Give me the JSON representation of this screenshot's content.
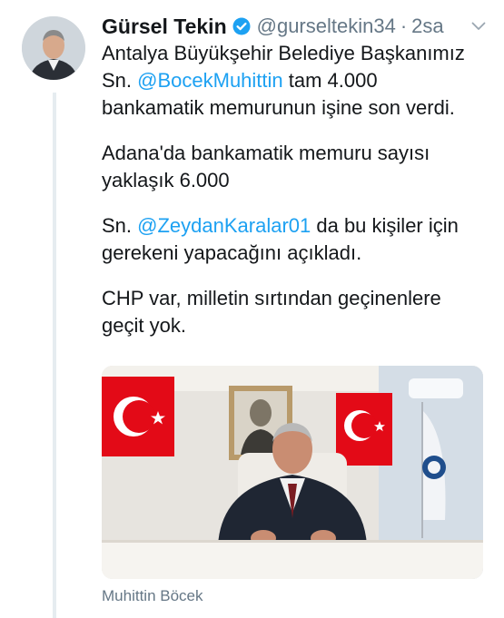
{
  "tweet": {
    "display_name": "Gürsel Tekin",
    "handle": "@gurseltekin34",
    "separator": "·",
    "time": "2sa",
    "paragraphs": [
      {
        "line1_pre": "Antalya Büyükşehir Belediye Başkanımız",
        "line2_pre": "Sn. ",
        "mention": "@BocekMuhittin",
        "line2_post": " tam 4.000",
        "line3": "bankamatik memurunun işine son verdi."
      },
      {
        "line1": "Adana'da bankamatik memuru sayısı",
        "line2": "yaklaşık 6.000"
      },
      {
        "pre": "Sn. ",
        "mention": "@ZeydanKaralar01",
        "post": " da bu kişiler için",
        "line2": "gerekeni yapacağını açıkladı."
      },
      {
        "line1": "CHP var, milletin sırtından geçinenlere",
        "line2": "geçit yok."
      }
    ],
    "media_caption": "Muhittin Böcek"
  },
  "icons": {
    "verified": "verified-badge-icon",
    "menu": "chevron-down-icon"
  },
  "colors": {
    "text": "#14171a",
    "secondary": "#657786",
    "link": "#1da1f2",
    "flag_red": "#e30a17"
  }
}
